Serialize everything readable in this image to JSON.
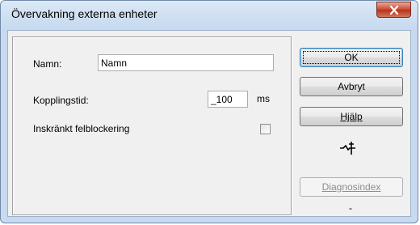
{
  "window": {
    "title": "Övervakning externa enheter",
    "close_icon": "close-icon"
  },
  "form": {
    "name_label": "Namn:",
    "name_value": "Namn",
    "switch_time_label": "Kopplingstid:",
    "switch_time_value": "_100",
    "switch_time_unit": "ms",
    "restricted_label": "Inskränkt felblockering",
    "restricted_checked": false
  },
  "buttons": {
    "ok": "OK",
    "cancel": "Avbryt",
    "help": "Hjälp",
    "diagnostic_index": "Diagnosindex"
  },
  "icons": {
    "switch_symbol": "switch-symbol-icon"
  },
  "status": {
    "dash": "-"
  }
}
